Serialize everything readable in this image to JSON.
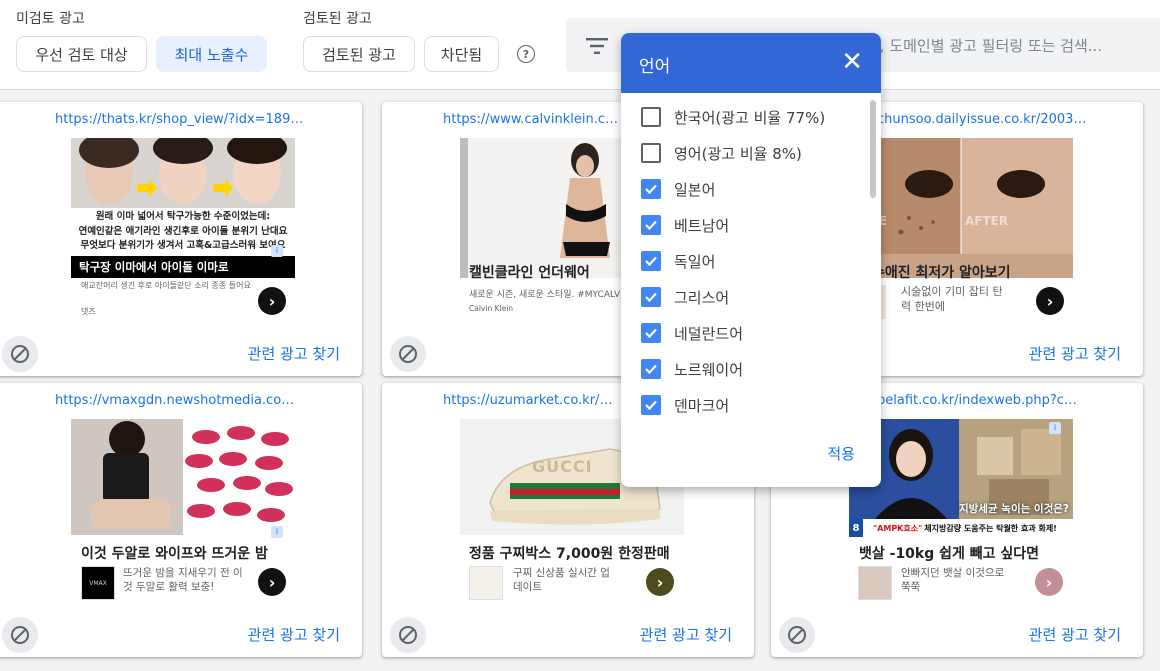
{
  "filters": {
    "unreviewed_label": "미검토 광고",
    "reviewed_label": "검토된 광고",
    "chips": {
      "priority": "우선 검토 대상",
      "max_exposure": "최대 노출수",
      "reviewed": "검토된 광고",
      "blocked": "차단됨"
    },
    "help": "?"
  },
  "search": {
    "placeholder": "RL, 도메인별 광고 필터링 또는 검색..."
  },
  "related_label": "관련 광고 찾기",
  "cards": [
    {
      "url": "https://thats.kr/shop_view/?idx=189&ut...",
      "headline1": "원래 이마 넓어서 탁구가능한 수준이었는데:",
      "headline2": "연예인같은 애기라인 생긴후로 아이돌 분위기 난대요",
      "headline3": "무엇보다 분위기가 생겨서 고혹&고급스러워 보여요",
      "caption": "탁구장 이마에서 아이돌 이마로",
      "desc": "애교잔머리 생긴 후로 아이돌같단 소리 종종 들어요",
      "advertiser": "댓즈"
    },
    {
      "url": "https://www.calvinklein.com/",
      "title": "캘빈클라인 언더웨어",
      "desc": "새로운 시즌, 새로운 스타일. #MYCALVINS",
      "advertiser": "Calvin Klein"
    },
    {
      "url": "chunsoo.dailyissue.co.kr/200312...",
      "before": "FORE",
      "after": "AFTER",
      "title": "수애진 최저가 알아보기",
      "desc": "시술없이 기미 잡티 탄력 한번에"
    },
    {
      "url": "https://vmaxgdn.newshotmedia.com/gn...",
      "title": "이것 두알로 와이프와 뜨거운 밤",
      "desc": "뜨거운 밤을 지새우기 전 이것 두알로 활력 보충!",
      "logo": "VMAX"
    },
    {
      "url": "https://uzumarket.co.kr/produ",
      "brand": "GUCCI",
      "title": "정품 구찌박스 7,000원 한정판매",
      "desc": "구찌 신상품 실시간 업데이트"
    },
    {
      "url": "belafit.co.kr/indexweb.php?cm_id...",
      "overlay": "지방세균 녹이는 이것은?",
      "ticker_num": "8",
      "ticker_brand": "\"AMPK효소\"",
      "ticker_text": "체지방감량 도움주는 탁월한 효과 화제!",
      "title": "뱃살 -10kg 쉽게 빼고 싶다면",
      "desc": "안빠지던 뱃살 이것으로 쭉쭉"
    }
  ],
  "language_menu": {
    "title": "언어",
    "close": "✕",
    "options": [
      {
        "label": "한국어(광고 비율 77%)",
        "checked": false
      },
      {
        "label": "영어(광고 비율 8%)",
        "checked": false
      },
      {
        "label": "일본어",
        "checked": true
      },
      {
        "label": "베트남어",
        "checked": true
      },
      {
        "label": "독일어",
        "checked": true
      },
      {
        "label": "그리스어",
        "checked": true
      },
      {
        "label": "네덜란드어",
        "checked": true
      },
      {
        "label": "노르웨이어",
        "checked": true
      },
      {
        "label": "덴마크어",
        "checked": true
      }
    ],
    "apply": "적용"
  },
  "colors": {
    "accent": "#1a73e8",
    "header": "#3367d6",
    "checkbox": "#4285f4"
  }
}
